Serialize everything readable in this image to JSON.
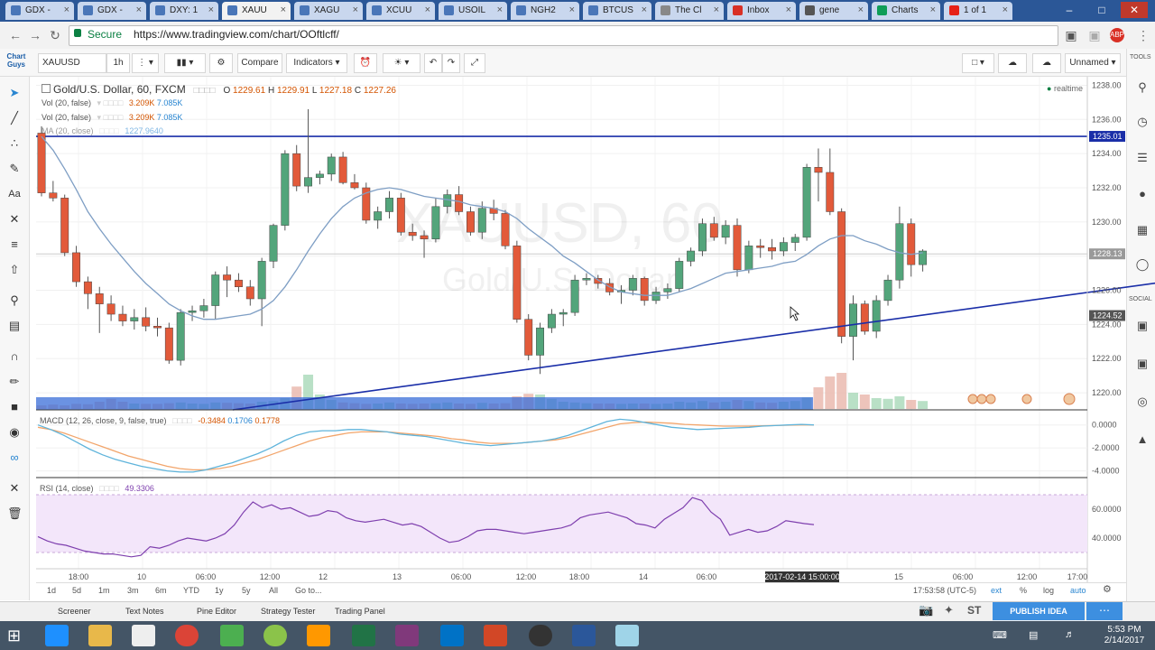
{
  "browser": {
    "tabs": [
      {
        "label": "GDX -",
        "color": "#4a76b8",
        "active": false
      },
      {
        "label": "GDX -",
        "color": "#4a76b8",
        "active": false
      },
      {
        "label": "DXY: 1",
        "color": "#4a76b8",
        "active": false
      },
      {
        "label": "XAUU",
        "color": "#4a76b8",
        "active": true
      },
      {
        "label": "XAGU",
        "color": "#4a76b8",
        "active": false
      },
      {
        "label": "XCUU",
        "color": "#4a76b8",
        "active": false
      },
      {
        "label": "USOIL",
        "color": "#4a76b8",
        "active": false
      },
      {
        "label": "NGH2",
        "color": "#4a76b8",
        "active": false
      },
      {
        "label": "BTCUS",
        "color": "#4a76b8",
        "active": false
      },
      {
        "label": "The Cl",
        "color": "#888888",
        "active": false
      },
      {
        "label": "Inbox",
        "color": "#d93025",
        "active": false
      },
      {
        "label": "gene",
        "color": "#555555",
        "active": false
      },
      {
        "label": "Charts",
        "color": "#0f9d58",
        "active": false
      },
      {
        "label": "1 of 1",
        "color": "#e62117",
        "active": false
      }
    ],
    "secure_label": "Secure",
    "url": "https://www.tradingview.com/chart/OOftlcff/"
  },
  "toolbar": {
    "symbol": "XAUUSD",
    "interval": "1h",
    "compare_label": "Compare",
    "indicators_label": "Indicators",
    "layout_name": "Unnamed"
  },
  "legend": {
    "main": "Gold/U.S. Dollar, 60, FXCM",
    "ohlc_o_label": "O",
    "ohlc_o": "1229.61",
    "ohlc_h_label": "H",
    "ohlc_h": "1229.91",
    "ohlc_l_label": "L",
    "ohlc_l": "1227.18",
    "ohlc_c_label": "C",
    "ohlc_c": "1227.26",
    "vol1": "Vol (20, false)",
    "vol1_a": "3.209K",
    "vol1_b": "7.085K",
    "vol2": "Vol (20, false)",
    "vol2_a": "3.209K",
    "vol2_b": "7.085K",
    "ma": "MA (20, close)",
    "ma_val": "1227.9640",
    "realtime": "realtime",
    "macd": "MACD (12, 26, close, 9, false, true)",
    "macd_a": "-0.3484",
    "macd_b": "0.1706",
    "macd_c": "0.1778",
    "rsi": "RSI (14, close)",
    "rsi_val": "49.3306"
  },
  "chart_data": {
    "type": "candlestick",
    "watermark_symbol": "XAUUSD, 60",
    "watermark_name": "Gold/U.S. Dollar",
    "price_ylim": [
      1219,
      1238.5
    ],
    "price_ticks": [
      "1238.00",
      "1236.00",
      "1234.00",
      "1232.00",
      "1230.00",
      "1228.00",
      "1226.00",
      "1224.00",
      "1222.00",
      "1220.00"
    ],
    "price_labels": [
      {
        "value": 1235.01,
        "text": "1235.01",
        "color": "#1a2ea8"
      },
      {
        "value": 1228.13,
        "text": "1228.13",
        "color": "#999999"
      },
      {
        "value": 1224.52,
        "text": "1224.52",
        "color": "#555555"
      }
    ],
    "time_ticks": [
      "18:00",
      "10",
      "06:00",
      "12:00",
      "12",
      "13",
      "06:00",
      "12:00",
      "18:00",
      "14",
      "06:00",
      "15",
      "06:00",
      "12:00",
      "17:00"
    ],
    "cursor_time": "2017-02-14 15:00:00",
    "candles": [
      [
        1235.2,
        1235.6,
        1231.5,
        1231.7
      ],
      [
        1231.7,
        1232.4,
        1231.2,
        1231.4
      ],
      [
        1231.4,
        1231.6,
        1228.0,
        1228.2
      ],
      [
        1228.2,
        1228.6,
        1226.2,
        1226.5
      ],
      [
        1226.5,
        1226.8,
        1224.9,
        1225.8
      ],
      [
        1225.8,
        1226.2,
        1223.5,
        1225.2
      ],
      [
        1225.2,
        1225.7,
        1224.2,
        1224.6
      ],
      [
        1224.6,
        1225.1,
        1223.9,
        1224.2
      ],
      [
        1224.2,
        1224.9,
        1223.7,
        1224.4
      ],
      [
        1224.4,
        1225.0,
        1223.6,
        1223.9
      ],
      [
        1223.9,
        1224.4,
        1223.3,
        1223.8
      ],
      [
        1223.8,
        1224.1,
        1221.7,
        1221.9
      ],
      [
        1221.9,
        1224.9,
        1221.6,
        1224.7
      ],
      [
        1224.7,
        1225.1,
        1224.2,
        1224.8
      ],
      [
        1224.8,
        1225.5,
        1224.4,
        1225.1
      ],
      [
        1225.1,
        1227.1,
        1224.3,
        1226.9
      ],
      [
        1226.9,
        1227.4,
        1225.6,
        1226.6
      ],
      [
        1226.6,
        1227.0,
        1225.9,
        1226.2
      ],
      [
        1226.2,
        1226.6,
        1225.1,
        1225.5
      ],
      [
        1225.5,
        1227.9,
        1223.9,
        1227.7
      ],
      [
        1227.7,
        1229.9,
        1227.3,
        1229.8
      ],
      [
        1229.8,
        1234.2,
        1229.5,
        1234.0
      ],
      [
        1234.0,
        1234.5,
        1231.8,
        1232.1
      ],
      [
        1232.1,
        1236.6,
        1231.7,
        1232.6
      ],
      [
        1232.6,
        1233.0,
        1232.2,
        1232.8
      ],
      [
        1232.8,
        1234.0,
        1232.4,
        1233.8
      ],
      [
        1233.8,
        1234.1,
        1232.2,
        1232.3
      ],
      [
        1232.3,
        1232.8,
        1231.9,
        1232.0
      ],
      [
        1232.0,
        1232.3,
        1229.9,
        1230.1
      ],
      [
        1230.1,
        1230.9,
        1229.6,
        1230.6
      ],
      [
        1230.6,
        1231.8,
        1230.2,
        1231.4
      ],
      [
        1231.4,
        1231.7,
        1229.2,
        1229.4
      ],
      [
        1229.4,
        1229.9,
        1228.9,
        1229.2
      ],
      [
        1229.2,
        1229.5,
        1227.9,
        1229.0
      ],
      [
        1229.0,
        1231.4,
        1228.8,
        1230.9
      ],
      [
        1230.9,
        1231.9,
        1230.5,
        1231.6
      ],
      [
        1231.6,
        1232.1,
        1230.4,
        1230.6
      ],
      [
        1230.6,
        1230.9,
        1229.2,
        1229.4
      ],
      [
        1229.4,
        1231.2,
        1229.0,
        1230.8
      ],
      [
        1230.8,
        1231.3,
        1230.1,
        1230.5
      ],
      [
        1230.5,
        1230.7,
        1228.4,
        1228.6
      ],
      [
        1228.6,
        1228.9,
        1224.1,
        1224.3
      ],
      [
        1224.3,
        1224.6,
        1221.9,
        1222.2
      ],
      [
        1222.2,
        1224.1,
        1221.1,
        1223.8
      ],
      [
        1223.8,
        1224.9,
        1223.5,
        1224.6
      ],
      [
        1224.6,
        1224.9,
        1223.9,
        1224.7
      ],
      [
        1224.7,
        1226.9,
        1224.5,
        1226.6
      ],
      [
        1226.6,
        1227.0,
        1226.3,
        1226.7
      ],
      [
        1226.7,
        1226.9,
        1226.1,
        1226.4
      ],
      [
        1226.4,
        1226.7,
        1225.7,
        1225.9
      ],
      [
        1225.9,
        1226.3,
        1225.2,
        1226.0
      ],
      [
        1226.0,
        1226.9,
        1225.7,
        1226.7
      ],
      [
        1226.7,
        1226.8,
        1225.1,
        1225.4
      ],
      [
        1225.4,
        1226.2,
        1225.2,
        1225.9
      ],
      [
        1225.9,
        1226.4,
        1225.5,
        1226.1
      ],
      [
        1226.1,
        1227.9,
        1225.9,
        1227.7
      ],
      [
        1227.7,
        1228.5,
        1227.4,
        1228.3
      ],
      [
        1228.3,
        1230.2,
        1228.0,
        1229.9
      ],
      [
        1229.9,
        1230.3,
        1228.9,
        1229.1
      ],
      [
        1229.1,
        1230.1,
        1228.7,
        1229.8
      ],
      [
        1229.8,
        1230.2,
        1226.8,
        1227.2
      ],
      [
        1227.2,
        1228.9,
        1227.0,
        1228.6
      ],
      [
        1228.6,
        1229.0,
        1227.9,
        1228.5
      ],
      [
        1228.5,
        1229.0,
        1227.8,
        1228.3
      ],
      [
        1228.3,
        1229.1,
        1228.0,
        1228.8
      ],
      [
        1228.8,
        1229.3,
        1228.3,
        1229.1
      ],
      [
        1229.1,
        1233.4,
        1228.9,
        1233.2
      ],
      [
        1233.2,
        1234.3,
        1231.2,
        1232.9
      ],
      [
        1232.9,
        1234.3,
        1230.4,
        1230.6
      ],
      [
        1230.6,
        1230.8,
        1222.9,
        1223.3
      ],
      [
        1223.3,
        1225.7,
        1221.9,
        1225.2
      ],
      [
        1225.2,
        1225.4,
        1223.4,
        1223.6
      ],
      [
        1223.6,
        1225.7,
        1223.2,
        1225.4
      ],
      [
        1225.4,
        1226.9,
        1225.1,
        1226.6
      ],
      [
        1226.6,
        1230.9,
        1226.1,
        1229.9
      ],
      [
        1229.9,
        1230.2,
        1226.8,
        1227.5
      ],
      [
        1227.5,
        1228.4,
        1227.1,
        1228.3
      ]
    ],
    "ma_values": [
      1235.0,
      1234.2,
      1233.1,
      1231.9,
      1230.6,
      1229.6,
      1228.7,
      1227.9,
      1227.1,
      1226.4,
      1225.8,
      1225.2,
      1224.8,
      1224.5,
      1224.3,
      1224.3,
      1224.4,
      1224.5,
      1224.6,
      1224.9,
      1225.4,
      1226.2,
      1227.2,
      1228.3,
      1229.3,
      1230.2,
      1230.9,
      1231.4,
      1231.7,
      1231.9,
      1232.0,
      1231.9,
      1231.7,
      1231.5,
      1231.4,
      1231.3,
      1231.2,
      1231.0,
      1230.9,
      1230.8,
      1230.6,
      1230.2,
      1229.6,
      1229.1,
      1228.6,
      1228.0,
      1227.6,
      1227.1,
      1226.6,
      1226.2,
      1225.9,
      1225.8,
      1225.7,
      1225.7,
      1225.7,
      1225.9,
      1226.1,
      1226.4,
      1226.7,
      1227.0,
      1227.1,
      1227.2,
      1227.3,
      1227.4,
      1227.6,
      1227.7,
      1228.1,
      1228.6,
      1229.0,
      1229.2,
      1229.2,
      1228.9,
      1228.7,
      1228.4,
      1228.2,
      1228.1,
      1228.2
    ],
    "volume": [
      0.1,
      0.12,
      0.1,
      0.14,
      0.13,
      0.2,
      0.28,
      0.2,
      0.15,
      0.14,
      0.14,
      0.16,
      0.18,
      0.15,
      0.14,
      0.18,
      0.17,
      0.16,
      0.15,
      0.2,
      0.22,
      0.3,
      0.62,
      0.95,
      0.4,
      0.25,
      0.18,
      0.16,
      0.14,
      0.15,
      0.18,
      0.15,
      0.14,
      0.15,
      0.16,
      0.18,
      0.15,
      0.14,
      0.17,
      0.15,
      0.16,
      0.35,
      0.42,
      0.4,
      0.28,
      0.2,
      0.18,
      0.16,
      0.15,
      0.15,
      0.14,
      0.15,
      0.15,
      0.14,
      0.15,
      0.2,
      0.18,
      0.22,
      0.18,
      0.2,
      0.25,
      0.22,
      0.18,
      0.17,
      0.2,
      0.22,
      0.32,
      0.6,
      0.9,
      1.0,
      0.45,
      0.4,
      0.3,
      0.28,
      0.35,
      0.25,
      0.22
    ],
    "hline_value": 1235.01,
    "trendline": {
      "x0_bar": 16.5,
      "y0": 1219.0,
      "x1_bar": 98.0,
      "y1": 1226.6
    },
    "macd_ticks": [
      "0.0000",
      "-2.0000",
      "-4.0000"
    ],
    "macd_ylim": [
      -4.5,
      1.0
    ],
    "macd_line": [
      0.0,
      -0.4,
      -0.9,
      -1.5,
      -2.1,
      -2.6,
      -3.0,
      -3.3,
      -3.6,
      -3.8,
      -4.0,
      -4.1,
      -4.1,
      -3.9,
      -3.6,
      -3.3,
      -2.9,
      -2.5,
      -2.0,
      -1.4,
      -0.9,
      -0.6,
      -0.5,
      -0.5,
      -0.4,
      -0.4,
      -0.5,
      -0.6,
      -0.8,
      -0.9,
      -1.0,
      -1.2,
      -1.4,
      -1.6,
      -1.7,
      -1.8,
      -1.7,
      -1.6,
      -1.5,
      -1.4,
      -1.2,
      -0.9,
      -0.5,
      -0.1,
      0.3,
      0.5,
      0.4,
      0.2,
      0.0,
      -0.2,
      -0.3,
      -0.4,
      -0.35,
      -0.3,
      -0.25,
      -0.2,
      -0.1,
      -0.05,
      0.0,
      0.05,
      0.0
    ],
    "signal_line": [
      -0.2,
      -0.4,
      -0.7,
      -1.1,
      -1.5,
      -1.9,
      -2.3,
      -2.7,
      -3.0,
      -3.3,
      -3.6,
      -3.8,
      -3.9,
      -3.9,
      -3.8,
      -3.6,
      -3.3,
      -3.0,
      -2.6,
      -2.2,
      -1.8,
      -1.4,
      -1.1,
      -0.9,
      -0.7,
      -0.6,
      -0.6,
      -0.6,
      -0.7,
      -0.8,
      -0.9,
      -1.0,
      -1.2,
      -1.3,
      -1.5,
      -1.6,
      -1.6,
      -1.6,
      -1.5,
      -1.4,
      -1.3,
      -1.1,
      -0.8,
      -0.5,
      -0.2,
      0.1,
      0.2,
      0.25,
      0.2,
      0.15,
      0.05,
      0.0,
      -0.05,
      -0.1,
      -0.1,
      -0.1,
      -0.08,
      -0.05,
      -0.02,
      0.0,
      0.0
    ],
    "rsi_ticks": [
      "60.0000",
      "40.0000"
    ],
    "rsi_ylim": [
      20,
      80
    ],
    "rsi_band": [
      30,
      70
    ],
    "rsi_values": [
      41,
      38,
      36,
      35,
      33,
      31,
      30,
      29,
      29,
      28,
      27,
      28,
      34,
      33,
      35,
      38,
      40,
      39,
      38,
      40,
      43,
      49,
      58,
      65,
      61,
      63,
      60,
      61,
      58,
      55,
      56,
      59,
      58,
      54,
      52,
      51,
      52,
      53,
      51,
      49,
      50,
      48,
      44,
      40,
      37,
      38,
      41,
      45,
      46,
      46,
      45,
      44,
      43,
      44,
      45,
      46,
      47,
      49,
      54,
      56,
      57,
      58,
      56,
      54,
      50,
      49,
      47,
      53,
      57,
      61,
      68,
      66,
      58,
      53,
      42,
      44,
      46,
      44,
      45,
      48,
      52,
      51,
      50,
      49.3
    ]
  },
  "range_bar": [
    "1d",
    "5d",
    "1m",
    "3m",
    "6m",
    "YTD",
    "1y",
    "5y",
    "All",
    "Go to..."
  ],
  "range_status": {
    "time": "17:53:58 (UTC-5)",
    "ext": "ext",
    "pct": "%",
    "log": "log",
    "auto": "auto"
  },
  "panels": [
    "Screener",
    "Text Notes",
    "Pine Editor",
    "Strategy Tester",
    "Trading Panel"
  ],
  "publish_label": "PUBLISH IDEA",
  "right_sidebar": {
    "tools_label": "TOOLS",
    "social_label": "SOCIAL"
  },
  "clock": {
    "time": "5:53 PM",
    "date": "2/14/2017"
  },
  "colors": {
    "up": "#53a57b",
    "down": "#e25a3a",
    "ma": "#7e9ec4",
    "hline": "#1a2ea8",
    "trend": "#1a2ea8",
    "macd": "#5fb4db",
    "signal": "#f2a56b",
    "rsi": "#7e3fae",
    "rsi_band": "#f3e6fa"
  }
}
